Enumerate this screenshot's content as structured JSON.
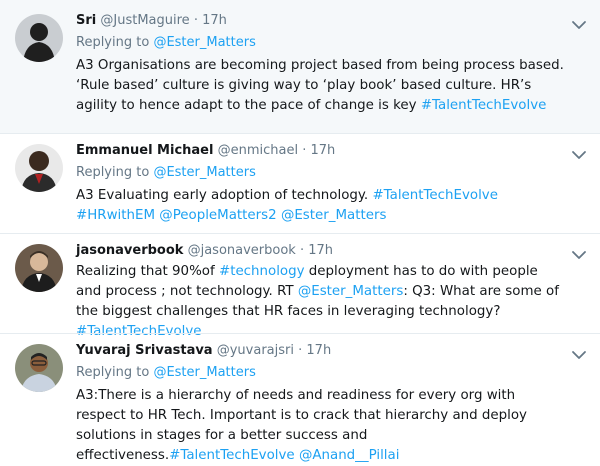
{
  "tweets": [
    {
      "name": "Sri",
      "handle": "@JustMaguire",
      "dot": "·",
      "time": "17h",
      "reply_prefix": "Replying to",
      "reply_to": "@Ester_Matters",
      "text": [
        "A3 Organisations are becoming project based from being  process based. ‘Rule based’ culture is giving way to ‘play book’ based culture. HR’s agility to hence adapt to the pace of change is key ",
        "#TalentTechEvolve"
      ]
    },
    {
      "name": "Emmanuel Michael",
      "handle": "@enmichael",
      "dot": "·",
      "time": "17h",
      "reply_prefix": "Replying to",
      "reply_to": "@Ester_Matters",
      "text": [
        "A3 Evaluating early adoption of technology. ",
        "#TalentTechEvolve",
        " ",
        "#HRwithEM",
        " ",
        "@PeopleMatters2",
        " ",
        "@Ester_Matters"
      ]
    },
    {
      "name": "jasonaverbook",
      "handle": "@jasonaverbook",
      "dot": "·",
      "time": "17h",
      "text": [
        "Realizing that 90%of ",
        "#technology",
        " deployment  has to do with people and process ;  not technology.  RT ",
        "@Ester_Matters",
        ": Q3: What are some of the biggest challenges that HR faces in leveraging technology? ",
        "#TalentTechEvolve"
      ]
    },
    {
      "name": "Yuvaraj Srivastava",
      "handle": "@yuvarajsri",
      "dot": "·",
      "time": "17h",
      "reply_prefix": "Replying to",
      "reply_to": "@Ester_Matters",
      "text": [
        "A3:There is a hierarchy of needs and readiness for every org with respect to HR Tech. Important is to crack that hierarchy and deploy solutions in stages for a better success and effectiveness.",
        "#TalentTechEvolve",
        " ",
        "@Anand__Pillai"
      ]
    }
  ],
  "icons": {
    "more_menu": "chevron-down-icon",
    "avatar": "avatar"
  },
  "colors": {
    "link": "#1da1f2",
    "secondary_text": "#657786",
    "highlight_bg": "#f5f8fa"
  }
}
